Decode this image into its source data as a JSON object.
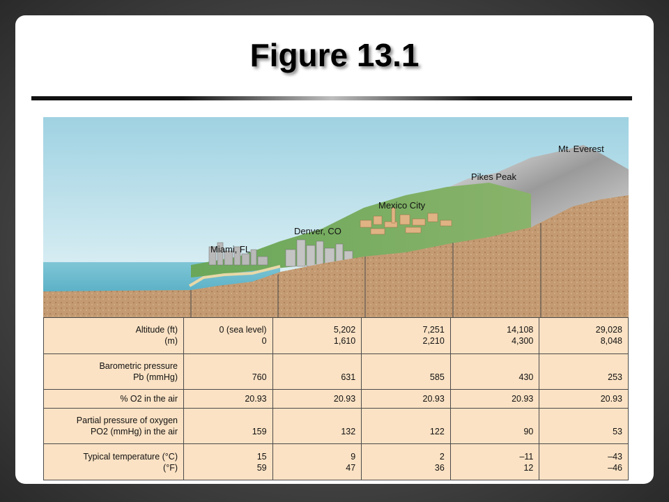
{
  "title": "Figure 13.1",
  "locations": [
    "Miami, FL",
    "Denver, CO",
    "Mexico City",
    "Pikes Peak",
    "Mt. Everest"
  ],
  "table": {
    "rows": [
      {
        "label": [
          "Altitude (ft)",
          "(m)"
        ],
        "values": [
          [
            "0 (sea level)",
            "0"
          ],
          [
            "5,202",
            "1,610"
          ],
          [
            "7,251",
            "2,210"
          ],
          [
            "14,108",
            "4,300"
          ],
          [
            "29,028",
            "8,048"
          ]
        ]
      },
      {
        "label": [
          "Barometric pressure",
          "Pb (mmHg)"
        ],
        "values": [
          [
            "760"
          ],
          [
            "631"
          ],
          [
            "585"
          ],
          [
            "430"
          ],
          [
            "253"
          ]
        ]
      },
      {
        "label": [
          "% O2 in the air"
        ],
        "values": [
          [
            "20.93"
          ],
          [
            "20.93"
          ],
          [
            "20.93"
          ],
          [
            "20.93"
          ],
          [
            "20.93"
          ]
        ]
      },
      {
        "label": [
          "Partial pressure of oxygen",
          "PO2 (mmHg) in the air"
        ],
        "values": [
          [
            "159"
          ],
          [
            "132"
          ],
          [
            "122"
          ],
          [
            "90"
          ],
          [
            "53"
          ]
        ]
      },
      {
        "label": [
          "Typical temperature (°C)",
          "(°F)"
        ],
        "values": [
          [
            "15",
            "59"
          ],
          [
            "9",
            "47"
          ],
          [
            "2",
            "36"
          ],
          [
            "–11",
            "12"
          ],
          [
            "–43",
            "–46"
          ]
        ]
      }
    ]
  }
}
